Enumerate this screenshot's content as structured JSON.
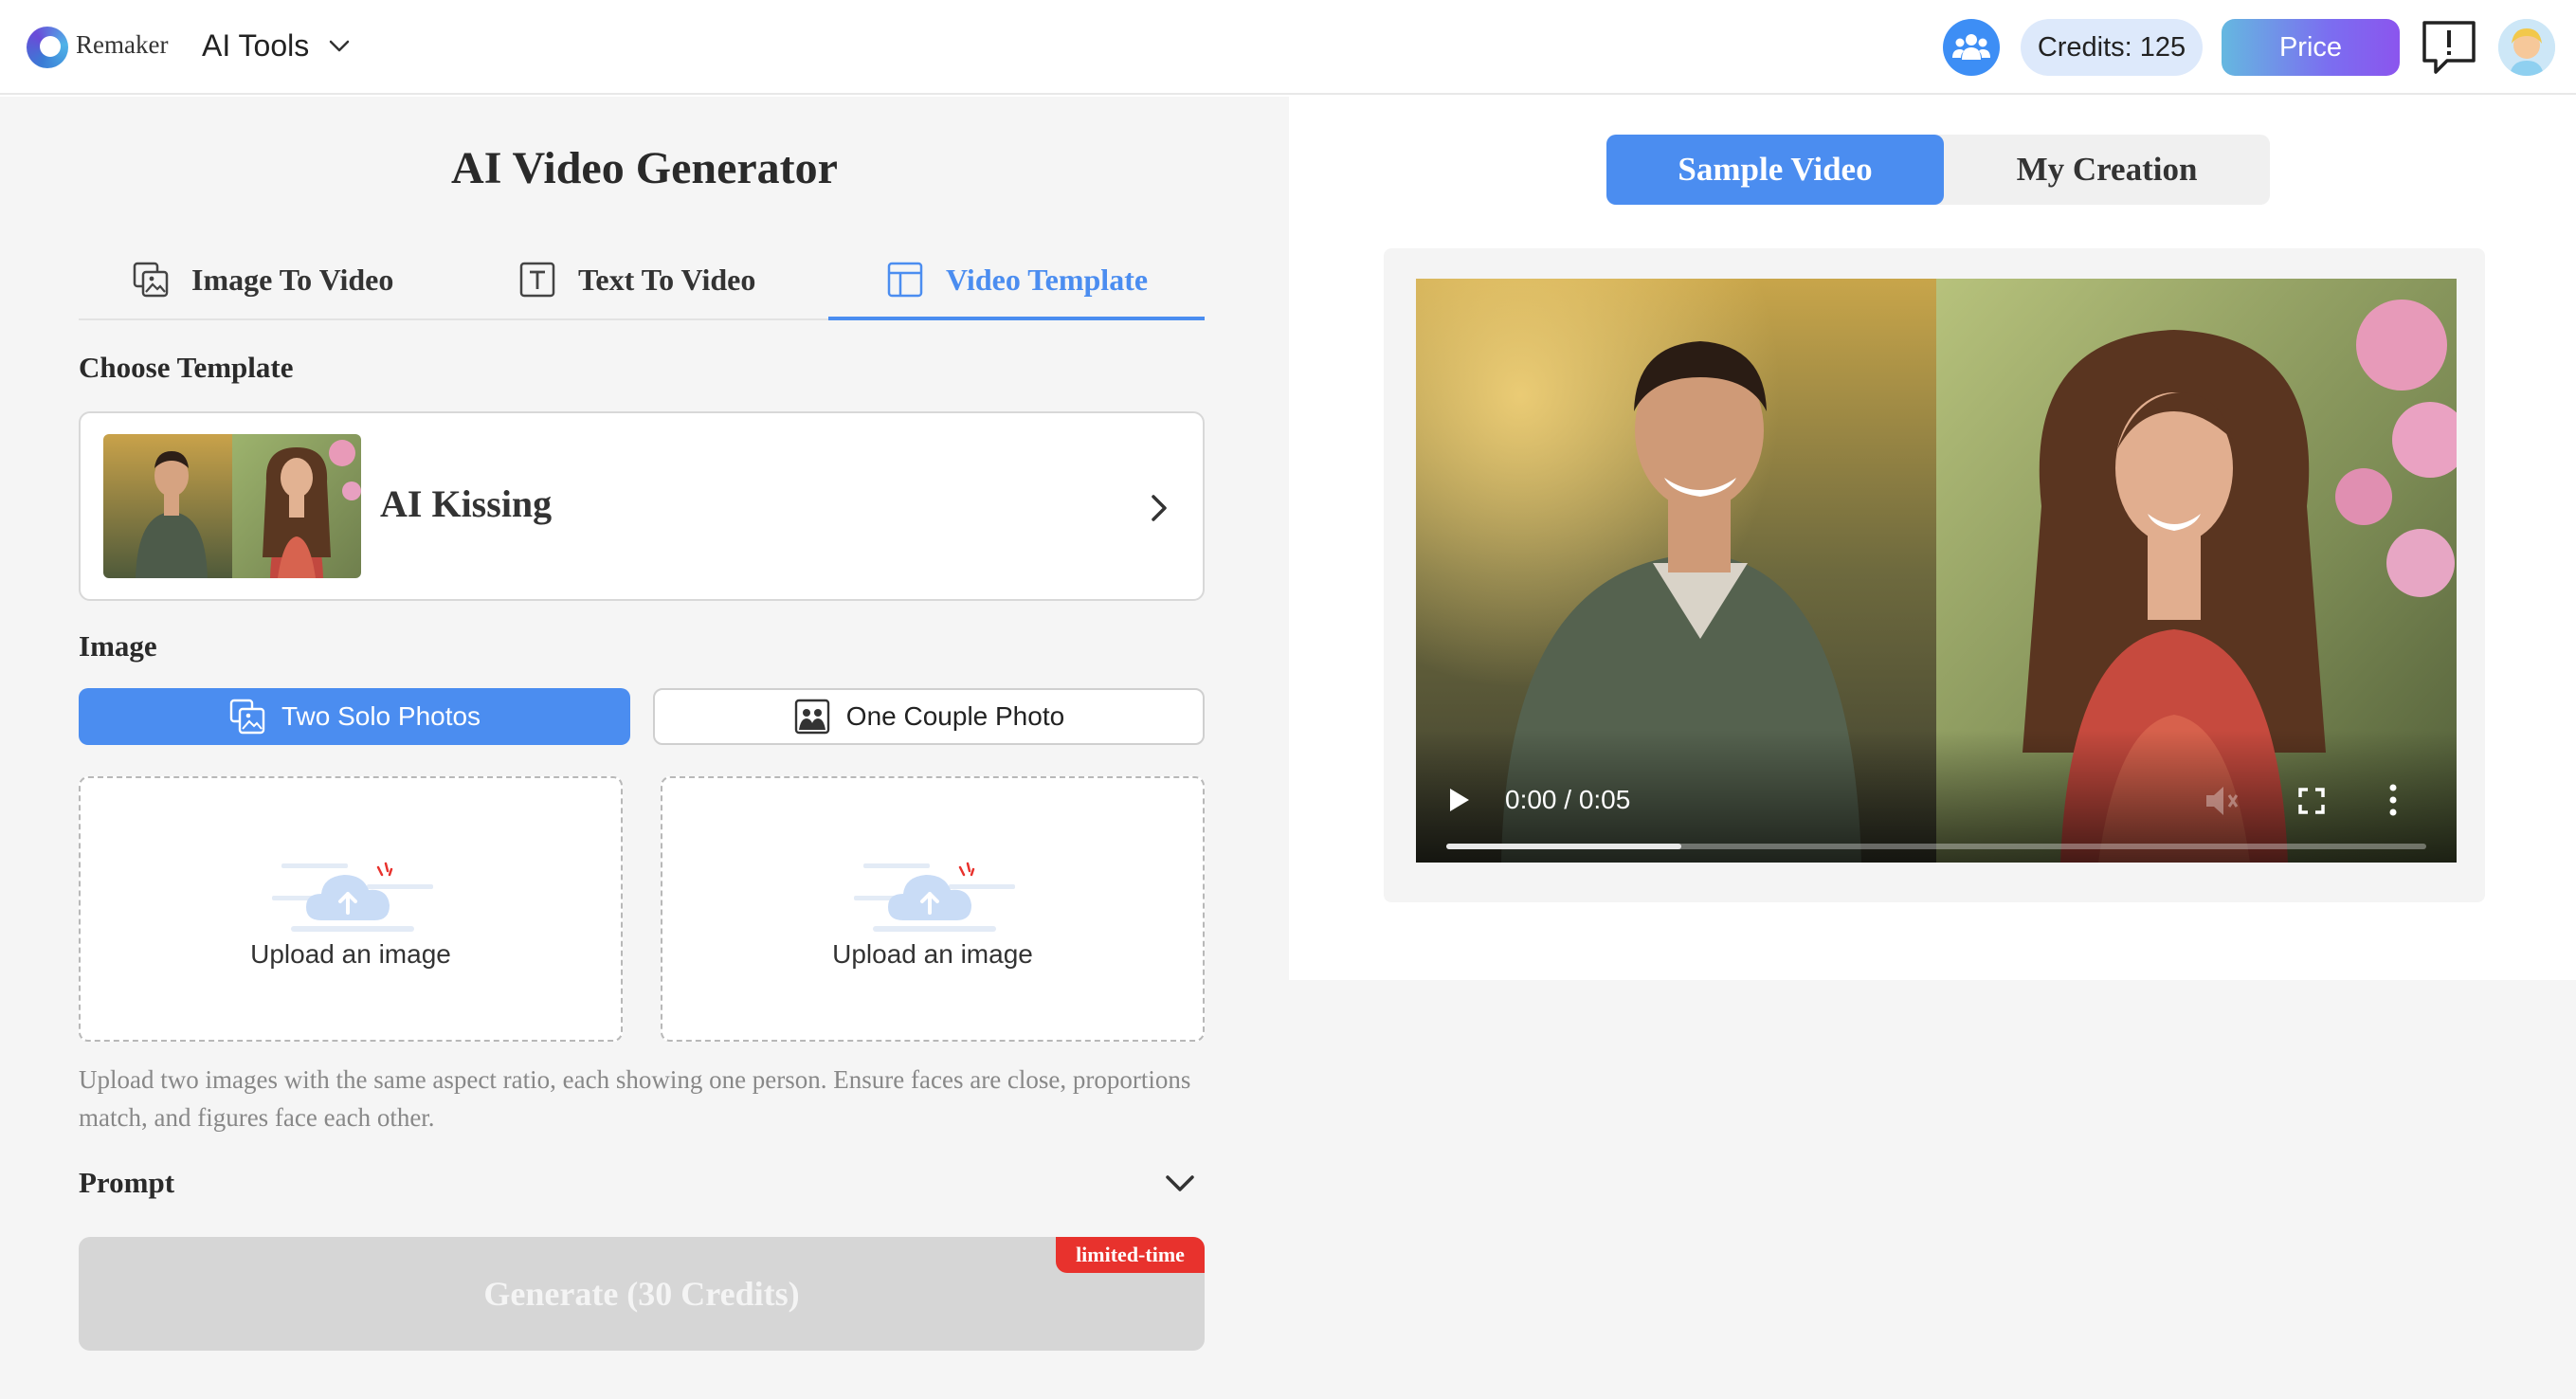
{
  "header": {
    "brand": "Remaker",
    "tools_menu": "AI Tools",
    "credits": "Credits: 125",
    "price_button": "Price"
  },
  "generator": {
    "title": "AI Video Generator",
    "tabs": [
      {
        "label": "Image To Video",
        "icon": "image-to-video-icon",
        "active": false
      },
      {
        "label": "Text To Video",
        "icon": "text-to-video-icon",
        "active": false
      },
      {
        "label": "Video Template",
        "icon": "template-icon",
        "active": true
      }
    ],
    "choose_template_label": "Choose Template",
    "template": {
      "name": "AI Kissing"
    },
    "image_label": "Image",
    "image_options": [
      {
        "label": "Two Solo Photos",
        "selected": true
      },
      {
        "label": "One Couple Photo",
        "selected": false
      }
    ],
    "upload_slots": [
      {
        "label": "Upload an image"
      },
      {
        "label": "Upload an image"
      }
    ],
    "hint": "Upload two images with the same aspect ratio, each showing one person. Ensure faces are close, proportions match, and figures face each other.",
    "prompt_label": "Prompt",
    "generate_button": "Generate (30 Credits)",
    "badge": "limited-time"
  },
  "preview": {
    "tabs": [
      {
        "label": "Sample Video",
        "active": true
      },
      {
        "label": "My Creation",
        "active": false
      }
    ],
    "video": {
      "time": "0:00 / 0:05",
      "progress_fraction": 0.24
    }
  },
  "colors": {
    "accent": "#4b8df0",
    "badge": "#e8322d",
    "disabled": "#d6d6d6"
  }
}
